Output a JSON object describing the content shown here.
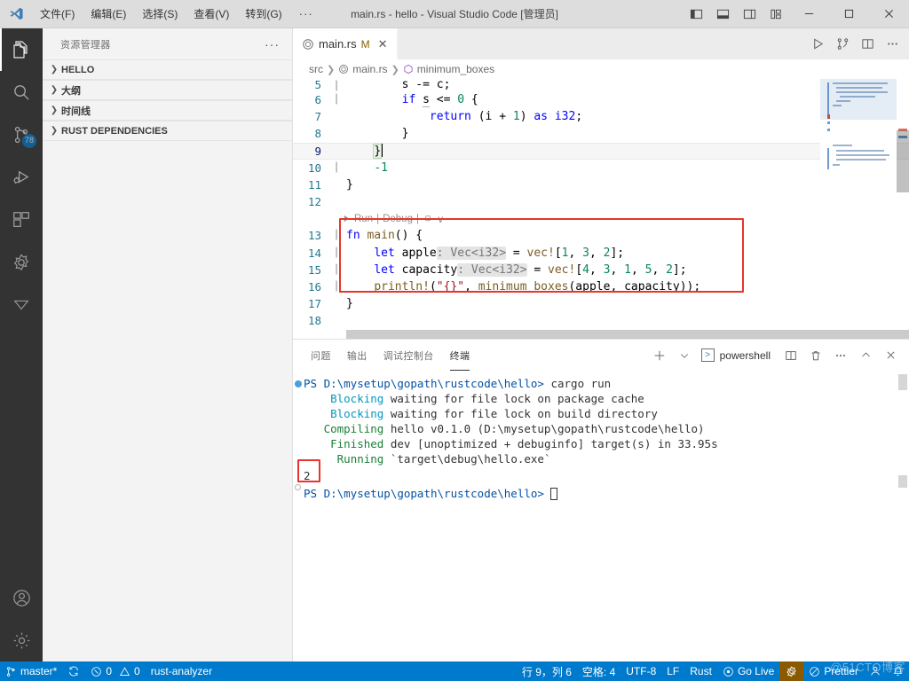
{
  "titlebar": {
    "logo_icon": "vscode-logo-icon",
    "menus": [
      "文件(F)",
      "编辑(E)",
      "选择(S)",
      "查看(V)",
      "转到(G)"
    ],
    "overflow_label": "···",
    "title": "main.rs - hello - Visual Studio Code [管理员]",
    "layout_buttons": [
      {
        "name": "toggle-primary-sidebar-icon"
      },
      {
        "name": "toggle-panel-icon"
      },
      {
        "name": "toggle-secondary-sidebar-icon"
      },
      {
        "name": "customize-layout-icon"
      }
    ],
    "window_controls": [
      {
        "name": "minimize-button",
        "glyph": "—"
      },
      {
        "name": "maximize-button",
        "glyph": "□"
      },
      {
        "name": "close-button",
        "glyph": "✕"
      }
    ]
  },
  "activitybar": {
    "items": [
      {
        "name": "explorer",
        "icon": "files-icon",
        "active": true,
        "badge": null
      },
      {
        "name": "search",
        "icon": "search-icon",
        "active": false,
        "badge": null
      },
      {
        "name": "source-control",
        "icon": "source-control-icon",
        "active": false,
        "badge": "78"
      },
      {
        "name": "run-and-debug",
        "icon": "run-debug-icon",
        "active": false,
        "badge": null
      },
      {
        "name": "extensions",
        "icon": "extensions-icon",
        "active": false,
        "badge": null
      },
      {
        "name": "rust-analyzer",
        "icon": "rust-icon",
        "active": false,
        "badge": null
      },
      {
        "name": "filter-view",
        "icon": "triangle-down-icon",
        "active": false,
        "badge": null
      }
    ],
    "bottom_items": [
      {
        "name": "accounts",
        "icon": "account-icon"
      },
      {
        "name": "manage",
        "icon": "gear-icon"
      }
    ]
  },
  "sidebar": {
    "title": "资源管理器",
    "more_actions": "···",
    "sections": [
      {
        "label": "HELLO",
        "expanded": false
      },
      {
        "label": "大纲",
        "expanded": false
      },
      {
        "label": "时间线",
        "expanded": false
      },
      {
        "label": "RUST DEPENDENCIES",
        "expanded": false
      }
    ]
  },
  "editor": {
    "tab": {
      "label": "main.rs",
      "modified_badge": "M",
      "close_glyph": "✕",
      "icon": "rust-file-icon"
    },
    "actions": [
      {
        "name": "run-code-button",
        "icon": "play-icon"
      },
      {
        "name": "open-changes-button",
        "icon": "compare-icon"
      },
      {
        "name": "split-editor-button",
        "icon": "split-editor-icon"
      },
      {
        "name": "more-actions-button",
        "icon": "ellipsis-icon"
      }
    ],
    "breadcrumb": [
      "src",
      "main.rs",
      "minimum_boxes"
    ],
    "codelens": {
      "run": "Run",
      "sep": "|",
      "debug": "Debug",
      "extra_icon": "rust-codelens-icon",
      "chevron": "∨"
    },
    "status_cursor": "行 9，列 6",
    "lines": [
      {
        "n": "5",
        "text": "        s -= c;",
        "clipped": true
      },
      {
        "n": "6",
        "text": "        if s <= 0 {"
      },
      {
        "n": "7",
        "text": "            return (i + 1) as i32;"
      },
      {
        "n": "8",
        "text": "        }"
      },
      {
        "n": "9",
        "text": "    }",
        "current": true
      },
      {
        "n": "10",
        "text": "    -1"
      },
      {
        "n": "11",
        "text": "}"
      },
      {
        "n": "12",
        "text": ""
      },
      {
        "n": "13",
        "text": "fn main() {"
      },
      {
        "n": "14",
        "text": "    let apple: Vec<i32> = vec![1, 3, 2];"
      },
      {
        "n": "15",
        "text": "    let capacity: Vec<i32> = vec![4, 3, 1, 5, 2];"
      },
      {
        "n": "16",
        "text": "    println!(\"{}\", minimum_boxes(apple, capacity));"
      },
      {
        "n": "17",
        "text": "}"
      },
      {
        "n": "18",
        "text": ""
      }
    ],
    "inlay_hints": [
      ": Vec<i32>",
      ": Vec<i32>"
    ],
    "highlight_box_note": "red-annotation-around-main-function"
  },
  "panel": {
    "tabs": [
      {
        "label": "问题",
        "active": false
      },
      {
        "label": "输出",
        "active": false
      },
      {
        "label": "调试控制台",
        "active": false
      },
      {
        "label": "终端",
        "active": true
      }
    ],
    "actions": [
      {
        "name": "new-terminal-button",
        "glyph": "+"
      },
      {
        "name": "terminal-dropdown-button",
        "glyph": "∨"
      },
      {
        "name": "split-terminal-button",
        "glyph": "split"
      },
      {
        "name": "kill-terminal-button",
        "glyph": "trash"
      },
      {
        "name": "panel-more-button",
        "glyph": "···"
      },
      {
        "name": "maximize-panel-button",
        "glyph": "∧"
      },
      {
        "name": "close-panel-button",
        "glyph": "✕"
      }
    ],
    "terminal_tab": {
      "label": "powershell",
      "icon": "terminal-chevron-icon"
    },
    "terminal": {
      "prompt_1": "PS D:\\mysetup\\gopath\\rustcode\\hello>",
      "command_1": "cargo run",
      "output": [
        {
          "tag": "Blocking",
          "tag_color": "cyan",
          "text": " waiting for file lock on package cache"
        },
        {
          "tag": "Blocking",
          "tag_color": "cyan",
          "text": " waiting for file lock on build directory"
        },
        {
          "tag": "Compiling",
          "tag_color": "green",
          "text": " hello v0.1.0 (D:\\mysetup\\gopath\\rustcode\\hello)"
        },
        {
          "tag": "Finished",
          "tag_color": "green",
          "text": " dev [unoptimized + debuginfo] target(s) in 33.95s"
        },
        {
          "tag": "Running",
          "tag_color": "green",
          "text": " `target\\debug\\hello.exe`"
        }
      ],
      "program_output": "2",
      "prompt_2": "PS D:\\mysetup\\gopath\\rustcode\\hello>"
    }
  },
  "statusbar": {
    "left": [
      {
        "name": "remote-branch",
        "icon": "source-control-icon",
        "label": "master*"
      },
      {
        "name": "sync-changes",
        "icon": "sync-icon",
        "label": ""
      },
      {
        "name": "problems",
        "icon": "error-warning-icon",
        "label": "0  0",
        "errors": "0",
        "warnings": "0"
      },
      {
        "name": "rust-analyzer-status",
        "icon": null,
        "label": "rust-analyzer"
      }
    ],
    "right": [
      {
        "name": "cursor-position",
        "label": "行 9，列 6"
      },
      {
        "name": "indentation",
        "label": "空格: 4"
      },
      {
        "name": "encoding",
        "label": "UTF-8"
      },
      {
        "name": "eol",
        "label": "LF"
      },
      {
        "name": "language-mode",
        "label": "Rust"
      },
      {
        "name": "go-live",
        "label": "Go Live",
        "icon": "broadcast-icon"
      },
      {
        "name": "rust-status",
        "label": "",
        "icon": "rust-icon",
        "background": "#8a5a00"
      },
      {
        "name": "prettier",
        "label": "Prettier",
        "icon": "prettier-icon"
      },
      {
        "name": "feedback",
        "label": "",
        "icon": "smiley-icon"
      },
      {
        "name": "notifications",
        "label": "",
        "icon": "bell-icon"
      }
    ],
    "watermark": "@51CTO博客",
    "accent_color": "#007acc"
  }
}
